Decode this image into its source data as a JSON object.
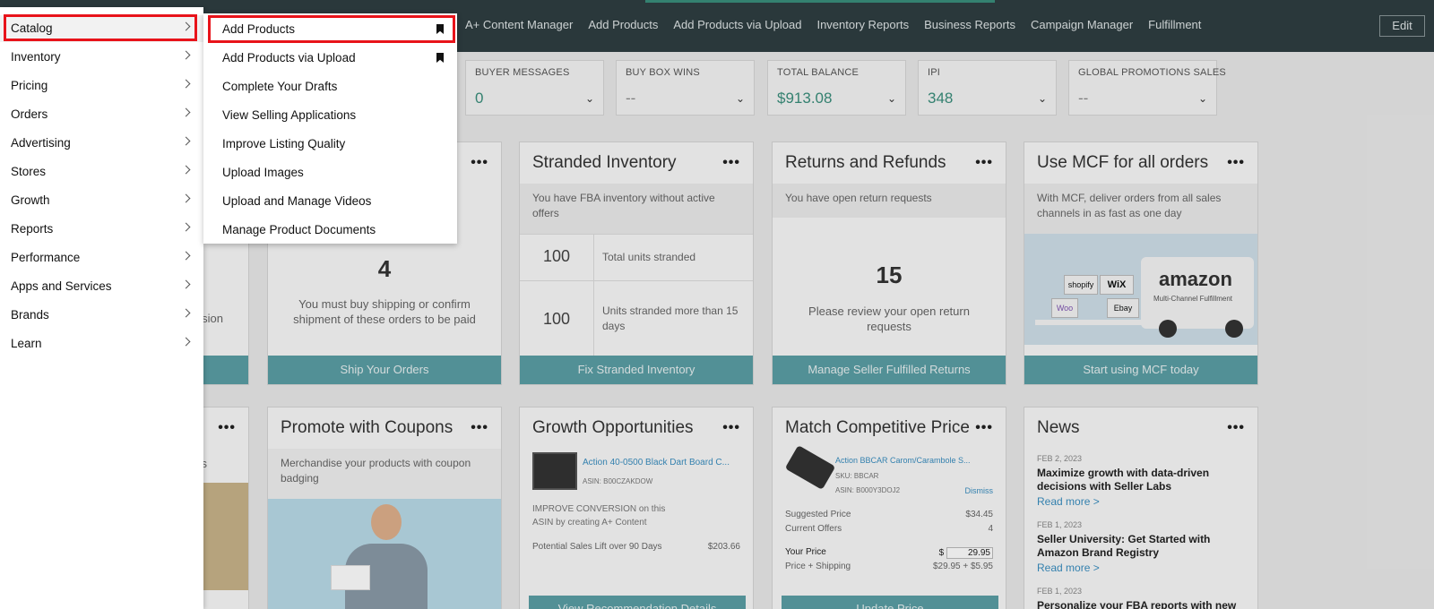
{
  "topnav": {
    "links": [
      "A+ Content Manager",
      "Add Products",
      "Add Products via Upload",
      "Inventory Reports",
      "Business Reports",
      "Campaign Manager",
      "Fulfillment"
    ],
    "edit_label": "Edit"
  },
  "metrics": [
    {
      "label": "BUYER MESSAGES",
      "value": "0"
    },
    {
      "label": "BUY BOX WINS",
      "value": "--"
    },
    {
      "label": "TOTAL BALANCE",
      "value": "$913.08"
    },
    {
      "label": "IPI",
      "value": "348"
    },
    {
      "label": "GLOBAL PROMOTIONS SALES",
      "value": "--"
    }
  ],
  "cards": {
    "left_partial_1": {
      "text": "sion"
    },
    "ship": {
      "number": "4",
      "text": "You must buy shipping or confirm shipment of these orders to be paid",
      "cta": "Ship Your Orders"
    },
    "stranded": {
      "title": "Stranded Inventory",
      "sub": "You have FBA inventory without active offers",
      "rows": [
        {
          "num": "100",
          "text": "Total units stranded"
        },
        {
          "num": "100",
          "text": "Units stranded more than 15 days"
        }
      ],
      "cta": "Fix Stranded Inventory"
    },
    "returns": {
      "title": "Returns and Refunds",
      "sub": "You have open return requests",
      "number": "15",
      "text": "Please review your open return requests",
      "cta": "Manage Seller Fulfilled Returns"
    },
    "mcf": {
      "title": "Use MCF for all orders",
      "sub": "With MCF, deliver orders from all sales channels in as fast as one day",
      "truck_brand": "amazon",
      "truck_sub": "Multi-Channel Fulfillment",
      "boxes": [
        "shopify",
        "WiX",
        "Woo",
        "Ebay"
      ],
      "cta": "Start using MCF today"
    },
    "left_partial_2": {
      "text": "s"
    },
    "coupons": {
      "title": "Promote with Coupons",
      "sub": "Merchandise your products with coupon badging"
    },
    "growth": {
      "title": "Growth Opportunities",
      "product": "Action 40-0500 Black Dart Board C...",
      "asin": "ASIN: B00CZAKDOW",
      "improve": "IMPROVE CONVERSION on this ASIN by creating A+ Content",
      "lift_label": "Potential Sales Lift over 90 Days",
      "lift_value": "$203.66",
      "cta": "View Recommendation Details"
    },
    "price": {
      "title": "Match Competitive Price",
      "product": "Action BBCAR Carom/Carambole S...",
      "sku": "SKU: BBCAR",
      "asin": "ASIN: B000Y3DOJ2",
      "dismiss": "Dismiss",
      "rows": [
        {
          "k": "Suggested Price",
          "v": "$34.45"
        },
        {
          "k": "Current Offers",
          "v": "4"
        }
      ],
      "your_price_label": "Your Price",
      "your_price_currency": "$",
      "your_price_value": "29.95",
      "ship_label": "Price + Shipping",
      "ship_value": "$29.95 + $5.95",
      "cta": "Update Price"
    },
    "news": {
      "title": "News",
      "items": [
        {
          "date": "FEB 2, 2023",
          "headline": "Maximize growth with data-driven decisions with Seller Labs",
          "link": "Read more >"
        },
        {
          "date": "FEB 1, 2023",
          "headline": "Seller University: Get Started with Amazon Brand Registry",
          "link": "Read more >"
        },
        {
          "date": "FEB 1, 2023",
          "headline": "Personalize your FBA reports with new"
        }
      ]
    }
  },
  "menu": {
    "items": [
      "Catalog",
      "Inventory",
      "Pricing",
      "Orders",
      "Advertising",
      "Stores",
      "Growth",
      "Reports",
      "Performance",
      "Apps and Services",
      "Brands",
      "Learn"
    ]
  },
  "submenu": {
    "items": [
      "Add Products",
      "Add Products via Upload",
      "Complete Your Drafts",
      "View Selling Applications",
      "Improve Listing Quality",
      "Upload Images",
      "Upload and Manage Videos",
      "Manage Product Documents"
    ]
  },
  "colors": {
    "highlight": "#e8131a",
    "accent": "#3a8e7c",
    "cta": "#5b9fa5"
  }
}
